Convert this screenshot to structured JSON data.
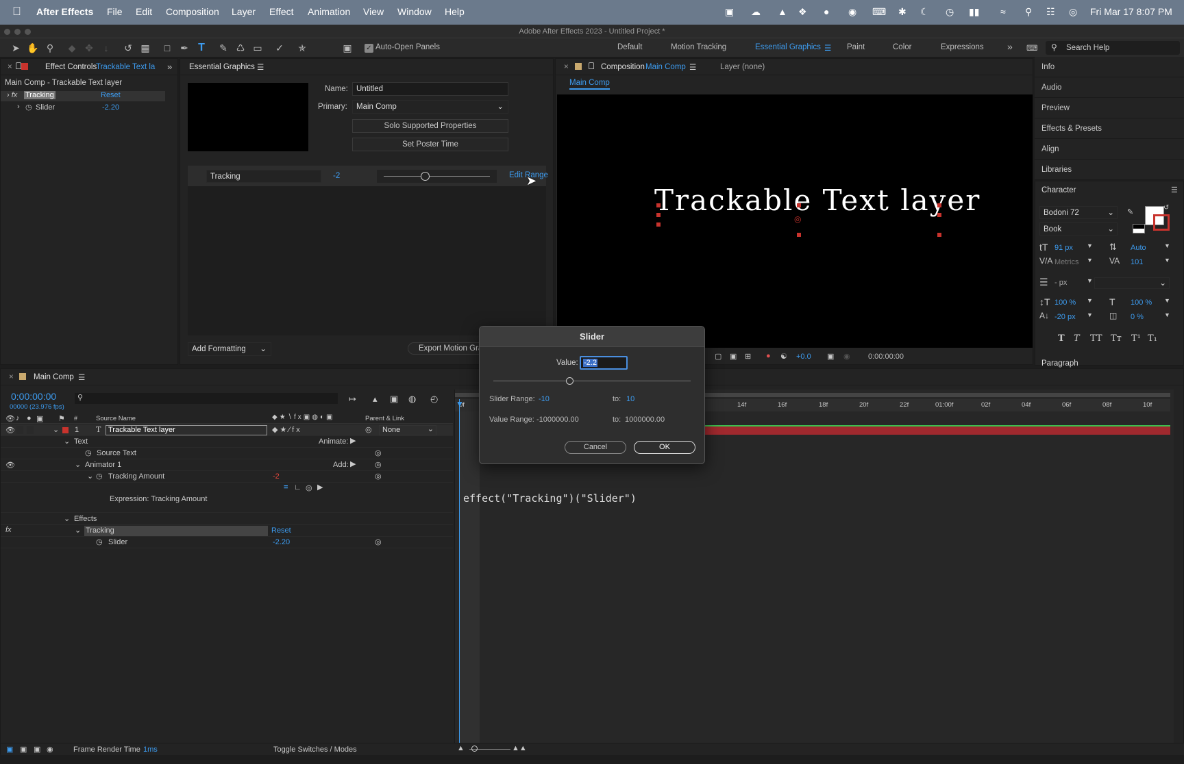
{
  "menubar": {
    "app": "After Effects",
    "items": [
      "File",
      "Edit",
      "Composition",
      "Layer",
      "Effect",
      "Animation",
      "View",
      "Window",
      "Help"
    ],
    "clock": "Fri Mar 17  8:07 PM"
  },
  "window_title": "Adobe After Effects 2023 - Untitled Project *",
  "toolbar": {
    "auto_open": "Auto-Open Panels",
    "workspaces": [
      "Default",
      "Motion Tracking",
      "Essential Graphics",
      "Paint",
      "Color",
      "Expressions"
    ],
    "search_placeholder": "Search Help"
  },
  "effect_controls": {
    "tab": "Effect Controls",
    "tab_layer": "Trackable Text la",
    "path": "Main Comp - Trackable Text layer",
    "effect_name": "Tracking",
    "reset": "Reset",
    "slider_label": "Slider",
    "slider_value": "-2.20"
  },
  "essential_graphics": {
    "tab": "Essential Graphics",
    "name_label": "Name:",
    "name_value": "Untitled",
    "primary_label": "Primary:",
    "primary_value": "Main Comp",
    "solo_btn": "Solo Supported Properties",
    "poster_btn": "Set Poster Time",
    "prop_name": "Tracking",
    "prop_value": "-2",
    "edit_range": "Edit Range",
    "add_formatting": "Add Formatting",
    "export_btn": "Export Motion Gra"
  },
  "composition": {
    "tab": "Composition",
    "tab_comp": "Main Comp",
    "layer_tab": "Layer (none)",
    "subtab": "Main Comp",
    "preview_text": "Trackable Text layer",
    "exposure": "+0.0",
    "timecode": "0:00:00:00"
  },
  "sidebar": {
    "items": [
      "Info",
      "Audio",
      "Preview",
      "Effects & Presets",
      "Align",
      "Libraries"
    ]
  },
  "character": {
    "title": "Character",
    "font": "Bodoni 72",
    "style": "Book",
    "size": "91 px",
    "leading": "Auto",
    "kerning": "Metrics",
    "tracking": "101",
    "stroke": "- px",
    "vscale": "100 %",
    "hscale": "100 %",
    "baseline": "-20 px",
    "tsume": "0 %",
    "styles": [
      "T",
      "T",
      "TT",
      "Tт",
      "T¹",
      "T₁"
    ],
    "paragraph": "Paragraph"
  },
  "timeline": {
    "tab": "Main Comp",
    "timecode": "0:00:00:00",
    "fps": "00000 (23.976 fps)",
    "col_source": "Source Name",
    "col_parent": "Parent & Link",
    "col_hash": "#",
    "layer_num": "1",
    "layer_name": "Trackable Text layer",
    "parent_value": "None",
    "text": "Text",
    "animate": "Animate:",
    "source_text": "Source Text",
    "animator": "Animator 1",
    "add": "Add:",
    "tracking_amount": "Tracking Amount",
    "tracking_amount_val": "-2",
    "expression_label": "Expression: Tracking Amount",
    "expression_code": "effect(\"Tracking\")(\"Slider\")",
    "effects": "Effects",
    "effect_tracking": "Tracking",
    "effect_reset": "Reset",
    "slider": "Slider",
    "slider_val": "-2.20",
    "ruler": [
      "0f",
      "14f",
      "16f",
      "18f",
      "20f",
      "22f",
      "01:00f",
      "02f",
      "04f",
      "06f",
      "08f",
      "10f"
    ],
    "frame_render": "Frame Render Time",
    "frame_render_val": "1ms",
    "toggle": "Toggle Switches / Modes"
  },
  "dialog": {
    "title": "Slider",
    "value_label": "Value:",
    "value": "-2.2",
    "slider_range_label": "Slider Range:",
    "slider_min": "-10",
    "to1": "to:",
    "slider_max": "10",
    "value_range_label": "Value Range:",
    "value_min": "-1000000.00",
    "to2": "to:",
    "value_max": "1000000.00",
    "cancel": "Cancel",
    "ok": "OK"
  },
  "colors": {
    "accent": "#3d9cf0",
    "menubar": "#6b7a8c",
    "layer_bar": "#a0292e",
    "dialog_ok": "#2e2e2e"
  }
}
